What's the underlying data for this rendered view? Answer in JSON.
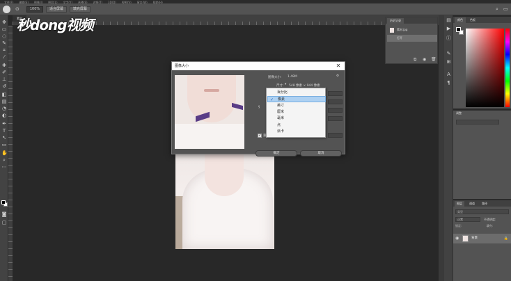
{
  "menubar": {
    "items": [
      "文件(F)",
      "编辑(E)",
      "图像(I)",
      "图层(L)",
      "文字(Y)",
      "选择(S)",
      "滤镜(T)",
      "3D(D)",
      "视图(V)",
      "窗口(W)",
      "帮助(H)"
    ]
  },
  "options": {
    "zoom_value": "100%",
    "fit_screen_label": "适合屏幕",
    "fill_screen_label": "填充屏幕"
  },
  "document": {
    "tab_label": "素材"
  },
  "watermark": {
    "text": "秒dong视频"
  },
  "dialog": {
    "title": "图像大小",
    "image_size_label": "图像大小:",
    "image_size_value": "1.48M",
    "dimensions_label": "尺寸:",
    "dimensions_value": "548 像素 × 944 像素",
    "fit_to_label": "调整为:",
    "width_label": "宽度(D):",
    "height_label": "高度(G):",
    "resolution_label": "分辨率(R):",
    "resample_label": "重新采样(S):",
    "ok_label": "确定",
    "cancel_label": "取消"
  },
  "unit_dropdown": {
    "selected": "像素",
    "options": [
      "百分比",
      "像素",
      "英寸",
      "厘米",
      "毫米",
      "点",
      "派卡"
    ]
  },
  "history_panel": {
    "tab_label": "历史记录",
    "rows": [
      {
        "label": "素材.jpg"
      },
      {
        "label": "打开"
      }
    ]
  },
  "color_panel": {
    "tabs": [
      "颜色",
      "色板"
    ]
  },
  "adjust_panel": {
    "tab_label": "调整"
  },
  "layers_panel": {
    "tabs": [
      "图层",
      "通道",
      "路径"
    ],
    "search_placeholder": "类型",
    "blend_mode": "正常",
    "opacity_label": "不透明度:",
    "lock_label": "锁定:",
    "fill_label": "填充:",
    "layer_name": "背景"
  }
}
